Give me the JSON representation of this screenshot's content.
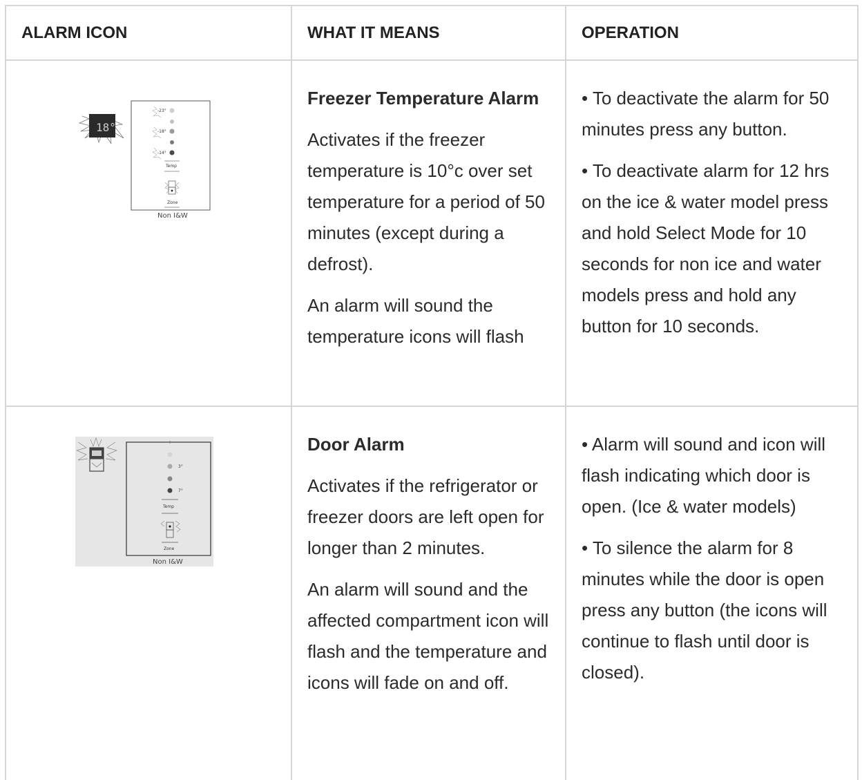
{
  "headers": {
    "alarm_icon": "ALARM ICON",
    "what_it_means": "WHAT IT MEANS",
    "operation": "OPERATION"
  },
  "rows": [
    {
      "illustration": {
        "display": "18°",
        "temps": [
          "-23°",
          "-18°",
          "-14°"
        ],
        "temp_label": "Temp",
        "zone_label": "Zone",
        "caption": "Non I&W"
      },
      "title": "Freezer Temperature Alarm",
      "meaning": [
        "Activates if the freezer temperature is 10°c over set temperature for a period of 50 minutes (except during a defrost).",
        "An alarm will sound the temperature icons will flash"
      ],
      "operation": [
        "• To deactivate the alarm for 50 minutes press any button.",
        "• To deactivate alarm for 12 hrs on the ice & water model press and hold Select Mode for 10 seconds for non ice and water models press and hold any button for 10 seconds."
      ]
    },
    {
      "illustration": {
        "temps": [
          "3°",
          "7°"
        ],
        "temp_label": "Temp",
        "zone_label": "Zone",
        "caption": "Non I&W",
        "background": "#e6e6e6"
      },
      "title": "Door Alarm",
      "meaning": [
        "Activates if the refrigerator or freezer doors are left open for longer than 2 minutes.",
        "An alarm will sound and the affected compartment icon will flash and the temperature and icons will fade on and off."
      ],
      "operation": [
        "• Alarm will sound and icon will flash indicating which door is open. (Ice & water models)",
        "• To silence the alarm for 8 minutes while the door is open press any button (the icons will continue to flash until door is closed)."
      ]
    }
  ]
}
